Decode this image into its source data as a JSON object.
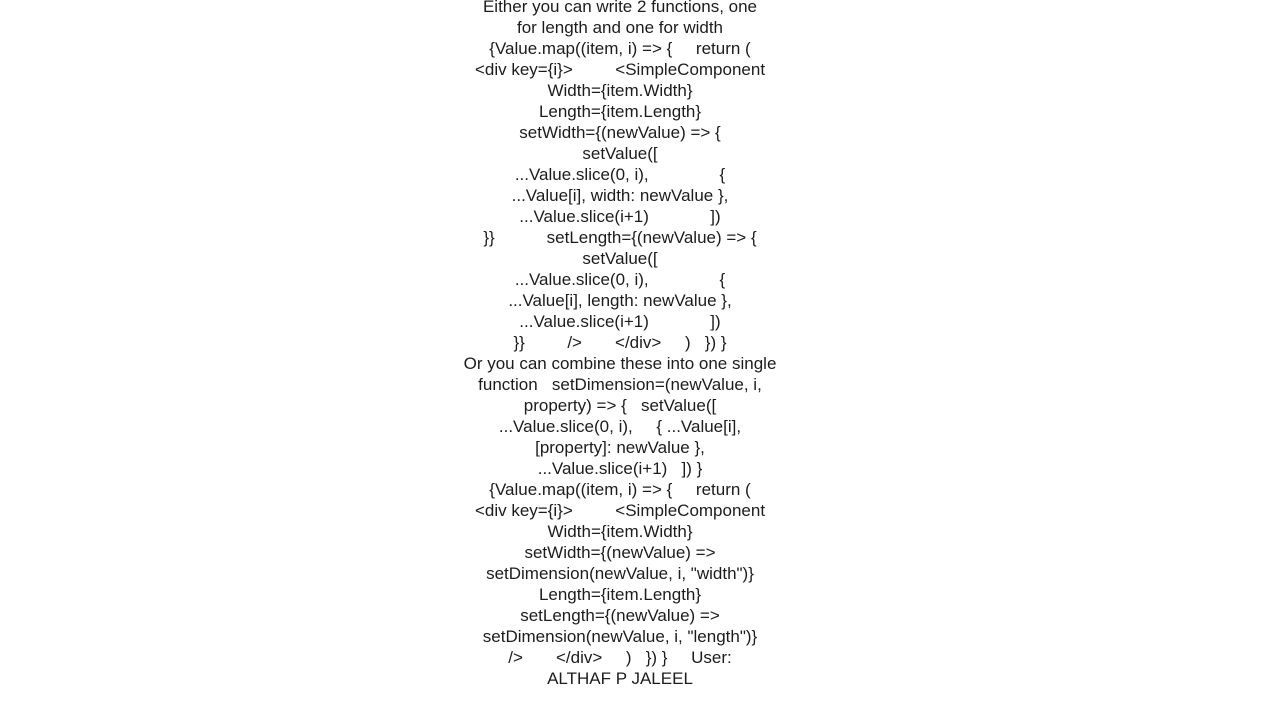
{
  "doc": {
    "lines": [
      "Either you can write 2 functions, one",
      "for length and one for width",
      "{Value.map((item, i) => {     return (",
      "<div key={i}>         <SimpleComponent",
      "Width={item.Width}",
      "Length={item.Length}",
      "setWidth={(newValue) => {",
      "setValue([",
      "...Value.slice(0, i),               {",
      "...Value[i], width: newValue },",
      "...Value.slice(i+1)             ])",
      "}}           setLength={(newValue) => {",
      "setValue([",
      "...Value.slice(0, i),               {",
      "...Value[i], length: newValue },",
      "...Value.slice(i+1)             ])",
      "}}         />       </div>     )   }) }",
      "Or you can combine these into one single",
      "function   setDimension=(newValue, i,",
      "property) => {   setValue([",
      "...Value.slice(0, i),     { ...Value[i],",
      "[property]: newValue },",
      "...Value.slice(i+1)   ]) }",
      "{Value.map((item, i) => {     return (",
      "<div key={i}>         <SimpleComponent",
      "Width={item.Width}",
      "setWidth={(newValue) =>",
      "setDimension(newValue, i, \"width\")}",
      "Length={item.Length}",
      "setLength={(newValue) =>",
      "setDimension(newValue, i, \"length\")}",
      "/>       </div>     )   }) }     User:",
      "ALTHAF P JALEEL"
    ]
  }
}
